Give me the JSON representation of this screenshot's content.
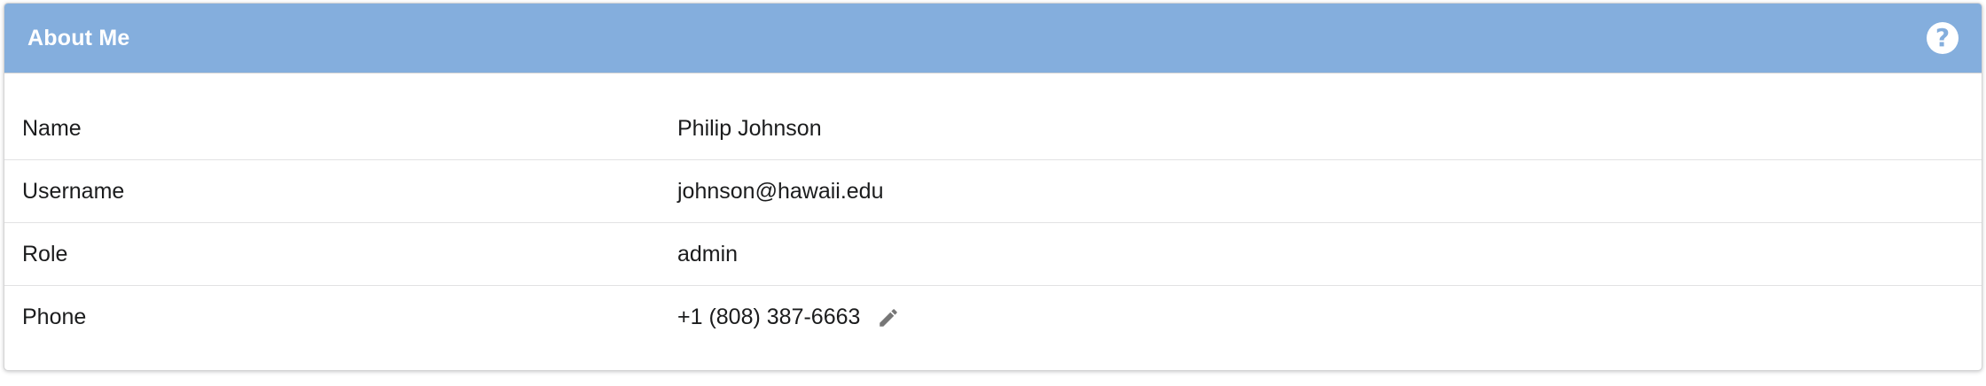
{
  "card": {
    "title": "About Me",
    "help_icon": "question-circle-icon"
  },
  "rows": [
    {
      "label": "Name",
      "value": "Philip Johnson"
    },
    {
      "label": "Username",
      "value": "johnson@hawaii.edu"
    },
    {
      "label": "Role",
      "value": "admin"
    },
    {
      "label": "Phone",
      "value": "+1 (808) 387-6663",
      "edit_icon": "pencil-icon"
    }
  ],
  "colors": {
    "header_bg": "#84aedd",
    "header_text": "#ffffff",
    "body_text": "#1b1c1d",
    "divider": "#e2e2e3",
    "icon_gray": "#767676"
  }
}
